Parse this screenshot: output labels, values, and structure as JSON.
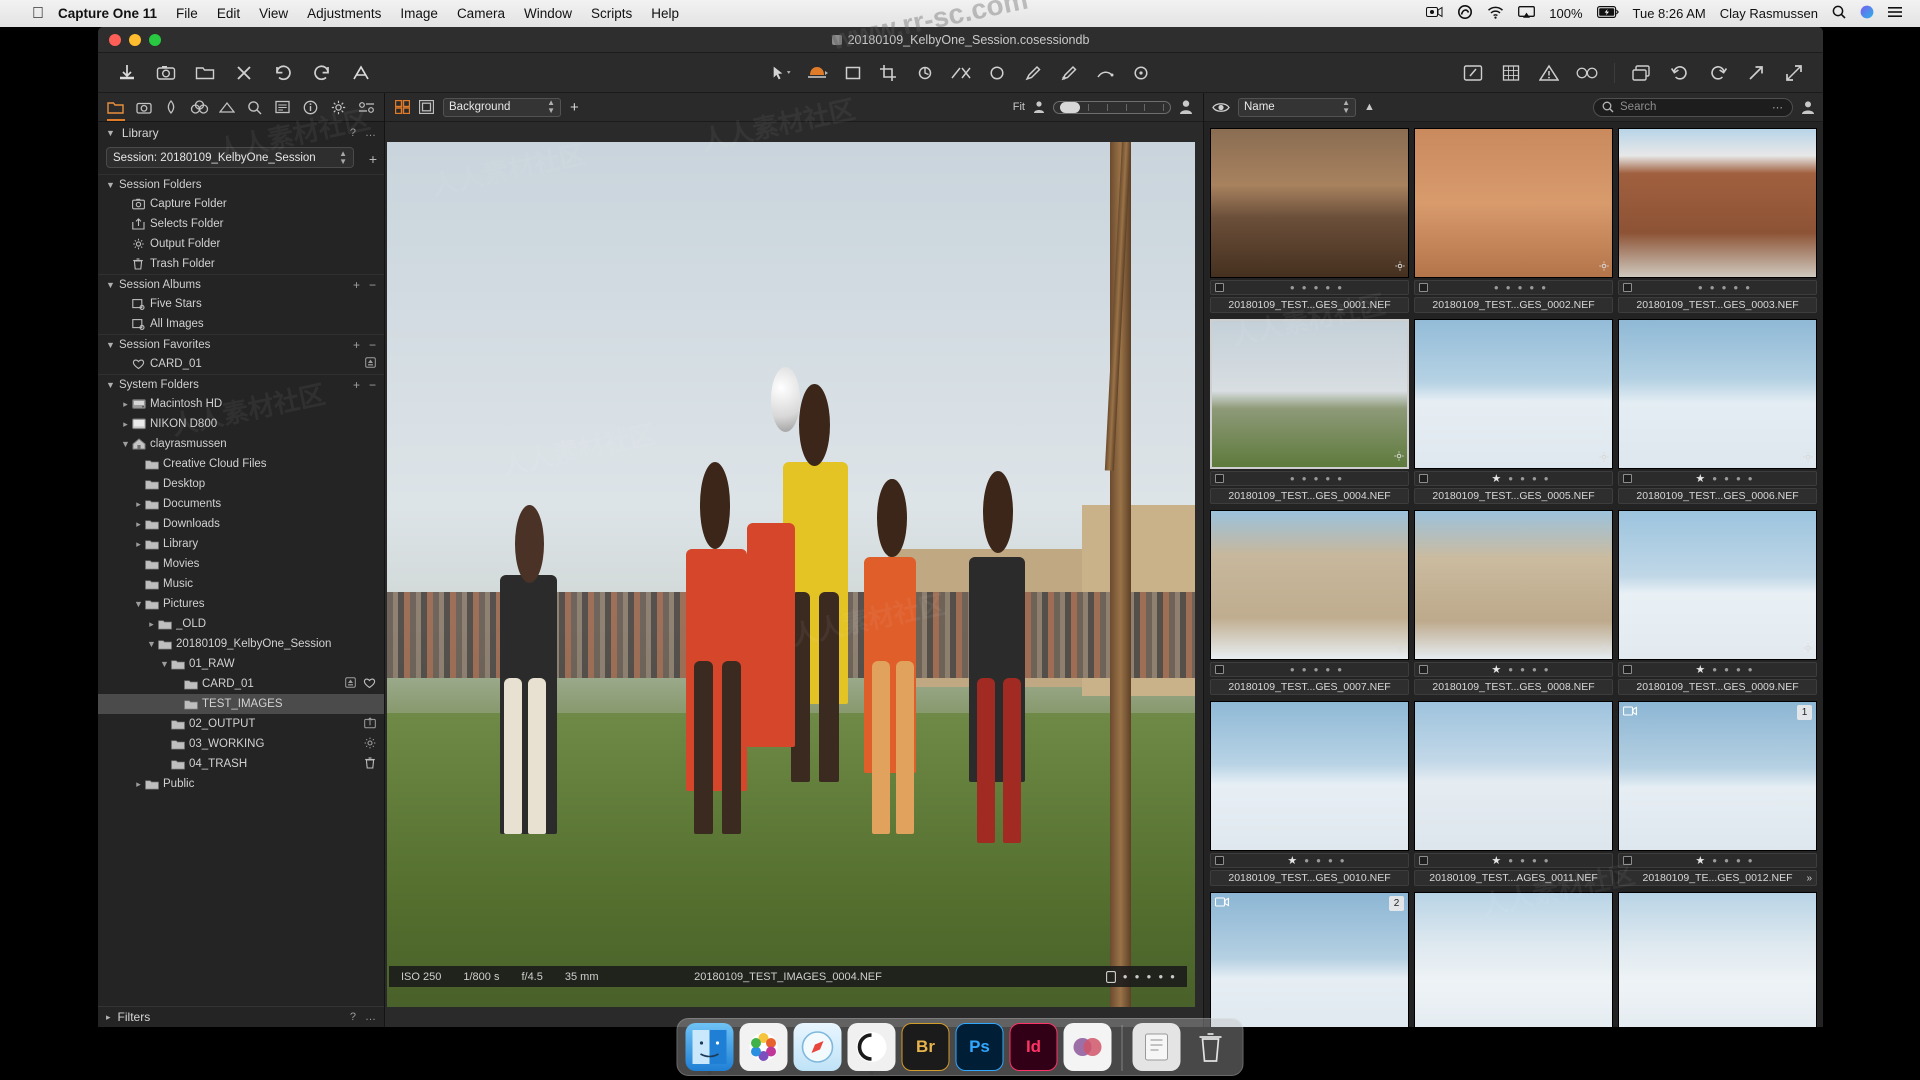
{
  "menubar": {
    "apple": "apple-logo",
    "items": [
      "Capture One 11",
      "File",
      "Edit",
      "View",
      "Adjustments",
      "Image",
      "Camera",
      "Window",
      "Scripts",
      "Help"
    ],
    "battery_percent": "100%",
    "clock": "Tue 8:26 AM",
    "user": "Clay Rasmussen",
    "status_icons": [
      "screen-record-icon",
      "creative-cloud-icon",
      "wifi-icon",
      "airplay-icon",
      "battery-icon",
      "search-icon",
      "siri-icon",
      "control-center-icon"
    ]
  },
  "window": {
    "title": "20180109_KelbyOne_Session.cosessiondb"
  },
  "toolbar": {
    "left": [
      "import-icon",
      "capture-icon",
      "new-folder-icon",
      "delete-icon",
      "undo-icon",
      "redo-icon",
      "text-tool-icon"
    ],
    "center": [
      "pointer-icon",
      "pan-icon",
      "crop-rect-icon",
      "crop-icon",
      "rotate-icon",
      "keystone-icon",
      "spot-removal-icon",
      "draw-mask-icon",
      "gradient-mask-icon",
      "heal-icon",
      "color-picker-icon"
    ],
    "right": [
      "edit-with-icon",
      "grid-overlay-icon",
      "warning-icon",
      "focus-mask-icon",
      "duplicate-icon",
      "rotate-left-icon",
      "rotate-right-icon",
      "export-icon",
      "fullscreen-icon"
    ]
  },
  "left_panel": {
    "tool_tabs": [
      "library-icon",
      "capture-icon",
      "lens-icon",
      "color-icon",
      "exposure-icon",
      "details-icon",
      "adjustments-icon",
      "metadata-icon",
      "output-icon",
      "custom-icon"
    ],
    "library": {
      "title": "Library",
      "help": "?",
      "more": "…",
      "session_select": "Session: 20180109_KelbyOne_Session",
      "add_label": "+"
    },
    "sections": [
      {
        "name": "Session Folders",
        "add": "",
        "remove": "",
        "items": [
          {
            "label": "Capture Folder",
            "icon": "capture-folder-icon",
            "indent": 1
          },
          {
            "label": "Selects Folder",
            "icon": "selects-folder-icon",
            "indent": 1
          },
          {
            "label": "Output Folder",
            "icon": "output-folder-icon",
            "indent": 1
          },
          {
            "label": "Trash Folder",
            "icon": "trash-folder-icon",
            "indent": 1
          }
        ]
      },
      {
        "name": "Session Albums",
        "add": "+",
        "remove": "−",
        "items": [
          {
            "label": "Five Stars",
            "icon": "album-icon",
            "indent": 1
          },
          {
            "label": "All Images",
            "icon": "album-icon",
            "indent": 1
          }
        ]
      },
      {
        "name": "Session Favorites",
        "add": "+",
        "remove": "−",
        "items": [
          {
            "label": "CARD_01",
            "icon": "heart-icon",
            "indent": 1,
            "trail": [
              "eject-icon"
            ]
          }
        ]
      },
      {
        "name": "System Folders",
        "add": "+",
        "remove": "−",
        "items": [
          {
            "label": "Macintosh HD",
            "icon": "hdd-icon",
            "indent": 1,
            "disc": "›"
          },
          {
            "label": "NIKON D800",
            "icon": "drive-icon",
            "indent": 1,
            "disc": "›"
          },
          {
            "label": "clayrasmussen",
            "icon": "home-icon",
            "indent": 1,
            "disc": "∨"
          },
          {
            "label": "Creative Cloud Files",
            "icon": "folder-icon",
            "indent": 2
          },
          {
            "label": "Desktop",
            "icon": "folder-icon",
            "indent": 2
          },
          {
            "label": "Documents",
            "icon": "folder-icon",
            "indent": 2,
            "disc": "›"
          },
          {
            "label": "Downloads",
            "icon": "folder-icon",
            "indent": 2,
            "disc": "›"
          },
          {
            "label": "Library",
            "icon": "folder-icon",
            "indent": 2,
            "disc": "›"
          },
          {
            "label": "Movies",
            "icon": "folder-icon",
            "indent": 2
          },
          {
            "label": "Music",
            "icon": "folder-icon",
            "indent": 2
          },
          {
            "label": "Pictures",
            "icon": "folder-icon",
            "indent": 2,
            "disc": "∨"
          },
          {
            "label": "_OLD",
            "icon": "folder-icon",
            "indent": 3,
            "disc": "›"
          },
          {
            "label": "20180109_KelbyOne_Session",
            "icon": "folder-icon",
            "indent": 3,
            "disc": "∨"
          },
          {
            "label": "01_RAW",
            "icon": "folder-icon",
            "indent": 4,
            "disc": "∨"
          },
          {
            "label": "CARD_01",
            "icon": "folder-icon",
            "indent": 5,
            "trail": [
              "eject-icon",
              "heart-icon"
            ]
          },
          {
            "label": "TEST_IMAGES",
            "icon": "folder-icon",
            "indent": 5,
            "selected": true
          },
          {
            "label": "02_OUTPUT",
            "icon": "folder-icon",
            "indent": 4,
            "trail": [
              "export-icon"
            ]
          },
          {
            "label": "03_WORKING",
            "icon": "folder-icon",
            "indent": 4,
            "trail": [
              "gear-icon"
            ]
          },
          {
            "label": "04_TRASH",
            "icon": "folder-icon",
            "indent": 4,
            "trail": [
              "trash-icon"
            ]
          },
          {
            "label": "Public",
            "icon": "folder-icon",
            "indent": 2,
            "disc": "›"
          }
        ]
      }
    ],
    "filters": {
      "title": "Filters",
      "help": "?",
      "more": "…"
    }
  },
  "viewer": {
    "background_select": "Background",
    "add_label": "+",
    "fit_label": "Fit",
    "icons": [
      "grid-view-icon",
      "single-view-icon",
      "add-variant-icon",
      "person-small-icon",
      "person-large-icon"
    ],
    "info": {
      "iso": "ISO 250",
      "shutter": "1/800 s",
      "aperture": "f/4.5",
      "focal": "35 mm",
      "filename": "20180109_TEST_IMAGES_0004.NEF",
      "stars": 0
    }
  },
  "browser": {
    "eye_icon": "eye-icon",
    "sort_select": "Name",
    "sort_direction": "▲",
    "search_placeholder": "Search",
    "search_value": "",
    "thumbnails": [
      {
        "filename": "20180109_TEST...GES_0001.NEF",
        "stars": 0,
        "scene": "portrait-wall",
        "corner": "settings-icon"
      },
      {
        "filename": "20180109_TEST...GES_0002.NEF",
        "stars": 0,
        "scene": "two-people-wall",
        "corner": "settings-icon"
      },
      {
        "filename": "20180109_TEST...GES_0003.NEF",
        "stars": 0,
        "scene": "red-house",
        "corner": ""
      },
      {
        "filename": "20180109_TEST...GES_0004.NEF",
        "stars": 0,
        "scene": "soccer",
        "selected": true,
        "corner": "settings-icon"
      },
      {
        "filename": "20180109_TEST...GES_0005.NEF",
        "stars": 1,
        "scene": "snow-street",
        "corner": "settings-icon"
      },
      {
        "filename": "20180109_TEST...GES_0006.NEF",
        "stars": 1,
        "scene": "snow-truck",
        "corner": "settings-icon"
      },
      {
        "filename": "20180109_TEST...GES_0007.NEF",
        "stars": 0,
        "scene": "tan-building",
        "corner": "settings-icon"
      },
      {
        "filename": "20180109_TEST...GES_0008.NEF",
        "stars": 1,
        "scene": "tan-building2",
        "corner": "settings-icon"
      },
      {
        "filename": "20180109_TEST...GES_0009.NEF",
        "stars": 1,
        "scene": "snow-field",
        "corner": "settings-icon"
      },
      {
        "filename": "20180109_TEST...GES_0010.NEF",
        "stars": 1,
        "scene": "snow-street2",
        "corner": ""
      },
      {
        "filename": "20180109_TEST...AGES_0011.NEF",
        "stars": 1,
        "scene": "snow-building",
        "corner": ""
      },
      {
        "filename": "20180109_TE...GES_0012.NEF",
        "stars": 1,
        "scene": "snow-hydrant",
        "badge": "1",
        "vbadge": "video-icon",
        "more": "»"
      },
      {
        "filename": "",
        "stars": 0,
        "scene": "snow-hydrant2",
        "badge": "2",
        "vbadge": "video-icon"
      },
      {
        "filename": "",
        "stars": 0,
        "scene": "white-house"
      },
      {
        "filename": "",
        "stars": 0,
        "scene": "white-house2"
      }
    ]
  },
  "dock": {
    "items": [
      {
        "name": "finder",
        "label": "",
        "color": "#2b8fe0"
      },
      {
        "name": "photos",
        "label": "",
        "color": "#d8d8d8"
      },
      {
        "name": "safari",
        "label": "",
        "color": "#3aa3e8"
      },
      {
        "name": "capture-one",
        "label": "",
        "color": "#2e2e2e"
      },
      {
        "name": "bridge",
        "label": "Br",
        "color": "#1b1b1b"
      },
      {
        "name": "photoshop",
        "label": "Ps",
        "color": "#001e36"
      },
      {
        "name": "indesign",
        "label": "Id",
        "color": "#310016"
      },
      {
        "name": "app-extra",
        "label": "",
        "color": "#9c6fa8"
      },
      {
        "name": "downloads-stack",
        "label": "",
        "color": "#c8c8c8"
      },
      {
        "name": "trash",
        "label": "",
        "color": "#d0d0d0"
      }
    ]
  },
  "watermark": {
    "text": "人人素材社区",
    "url": "www.rr-sc.com"
  }
}
